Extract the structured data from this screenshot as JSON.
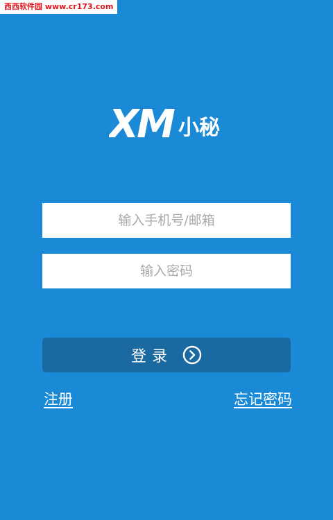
{
  "watermark": {
    "text": "西西软件园 www.cr173.com"
  },
  "logo": {
    "text_latin": "XM",
    "text_cn": "小秘"
  },
  "form": {
    "phone_placeholder": "输入手机号/邮箱",
    "password_placeholder": "输入密码"
  },
  "login_button": {
    "label": "登录",
    "icon": "chevron-right-circle-icon"
  },
  "links": {
    "register": "注册",
    "forgot_password": "忘记密码"
  },
  "colors": {
    "background": "#1a8ad6",
    "button": "#1a6aa1",
    "input_bg": "#ffffff",
    "placeholder": "#a9a9a9",
    "watermark_text": "#e0161f"
  }
}
